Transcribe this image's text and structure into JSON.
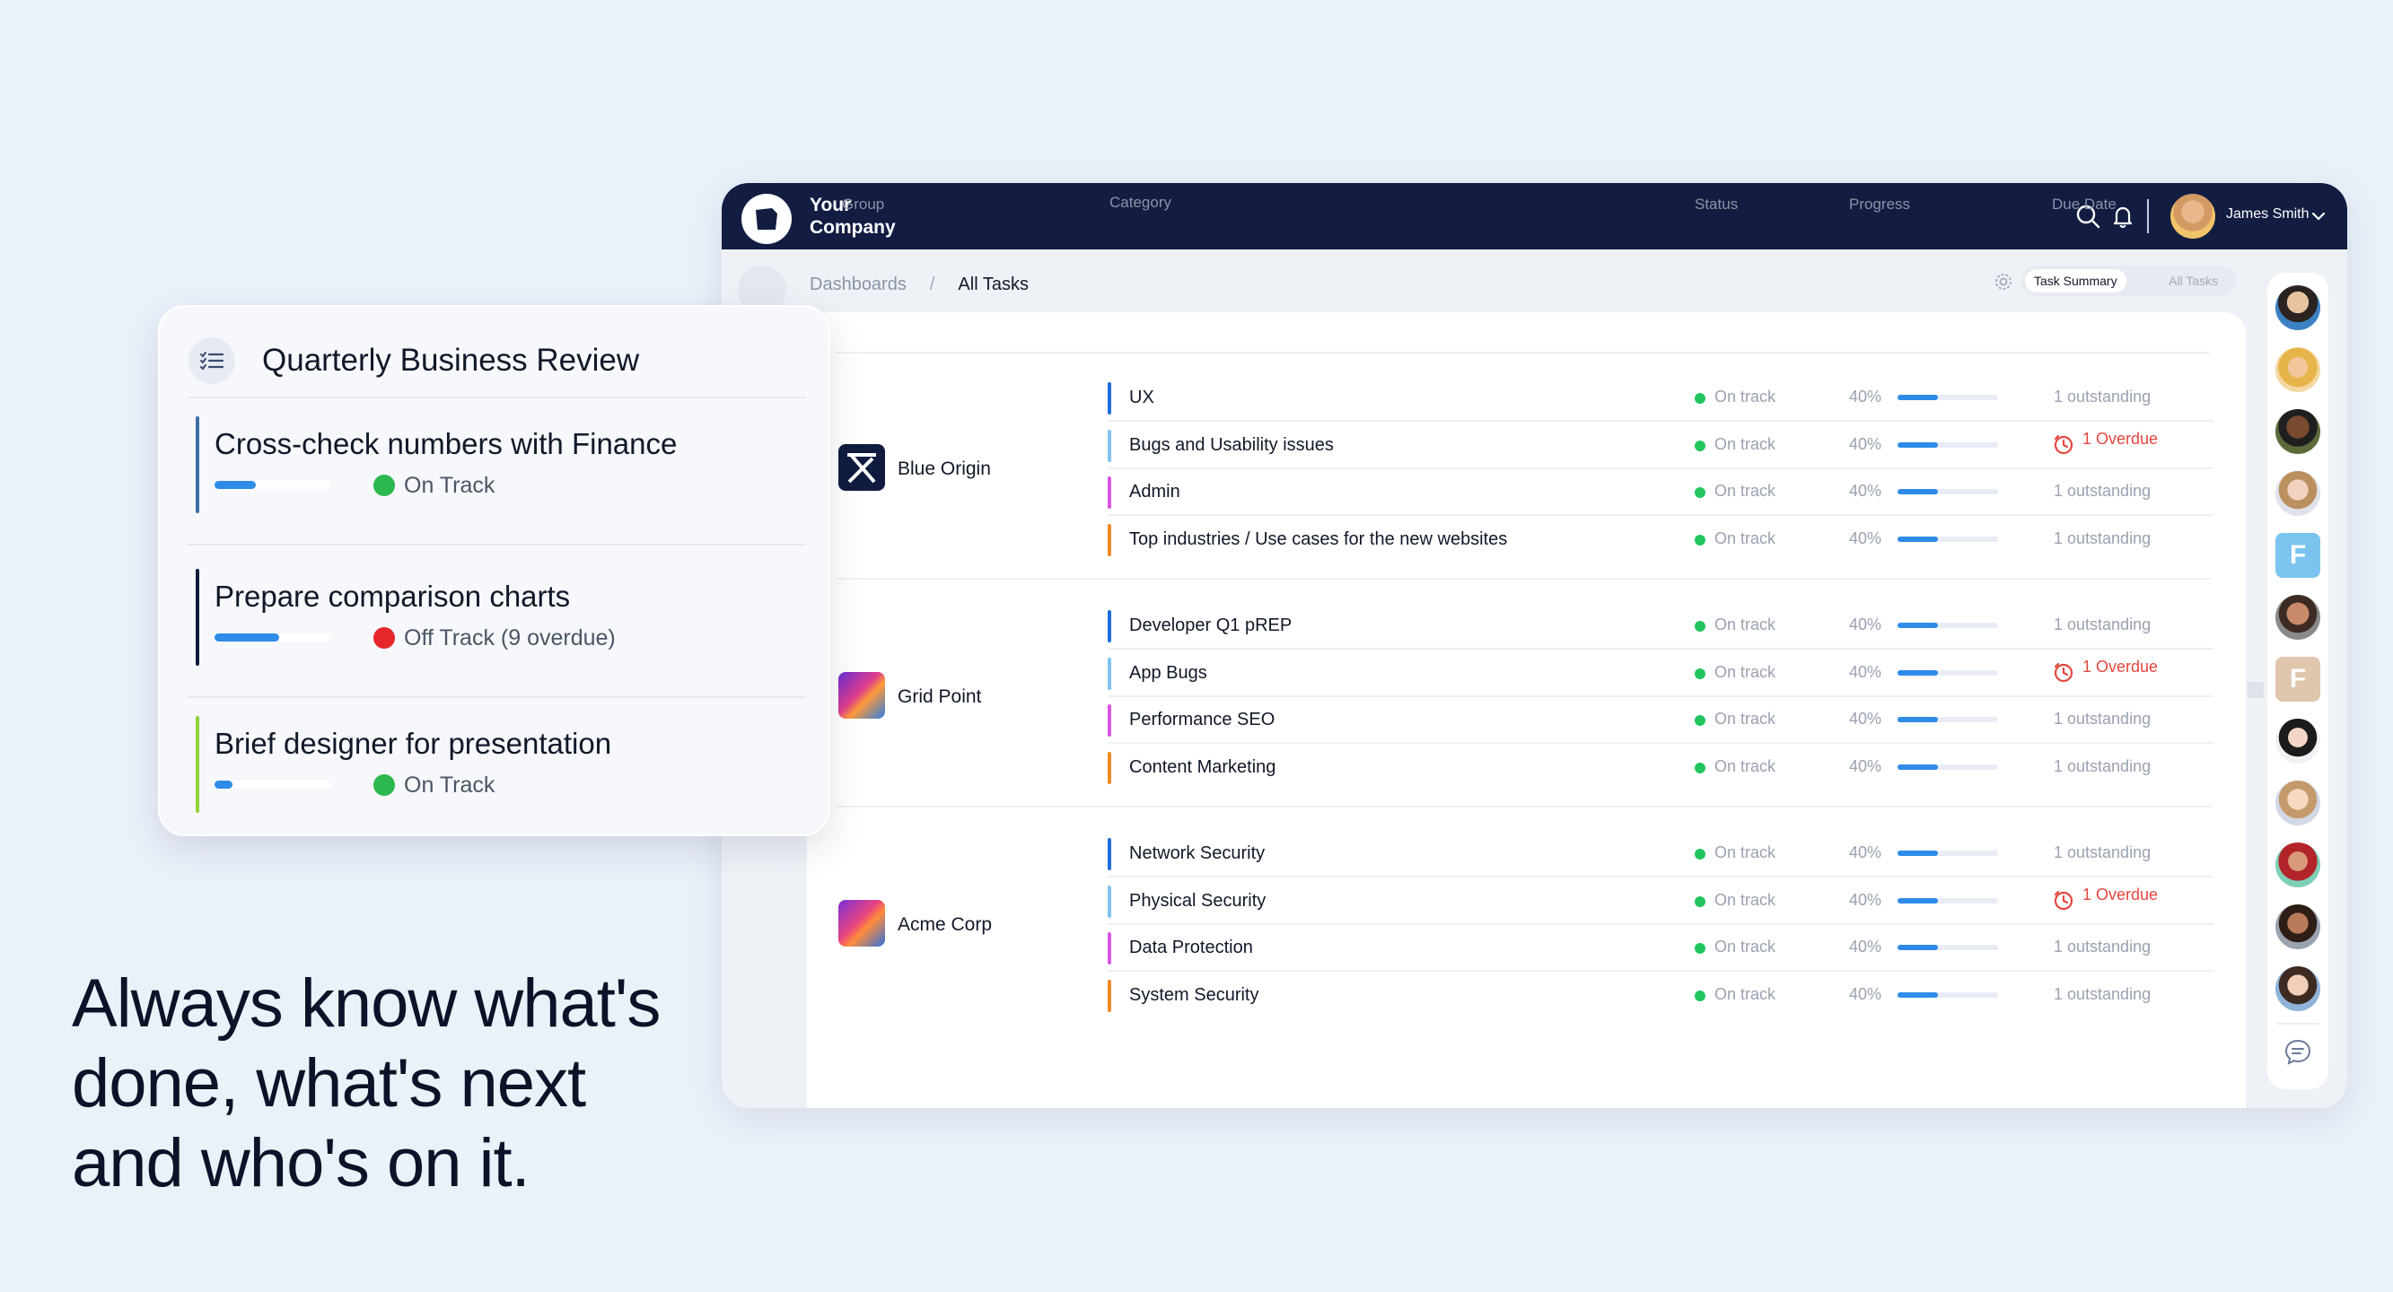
{
  "app": {
    "brand": "Your\nCompany",
    "user_name": "James Smith",
    "breadcrumbs": [
      "Dashboards",
      "/",
      "All Tasks"
    ],
    "view_toggle": {
      "active": "Task Summary",
      "other": "All Tasks"
    },
    "columns": [
      "Group",
      "Category",
      "Status",
      "Progress",
      "Due Date"
    ],
    "groups": [
      {
        "name": "Blue Origin",
        "rows": [
          {
            "category": "UX",
            "bar_color": "#1e6fd9",
            "status": "On track",
            "progress": "40%",
            "progress_value": 0.4,
            "due": "1 outstanding",
            "overdue": false
          },
          {
            "category": "Bugs and Usability issues",
            "bar_color": "#7fc3f2",
            "status": "On track",
            "progress": "40%",
            "progress_value": 0.4,
            "due": "1 Overdue",
            "overdue": true
          },
          {
            "category": "Admin",
            "bar_color": "#d957e0",
            "status": "On track",
            "progress": "40%",
            "progress_value": 0.4,
            "due": "1 outstanding",
            "overdue": false
          },
          {
            "category": "Top industries / Use cases for the new websites",
            "bar_color": "#f08a24",
            "status": "On track",
            "progress": "40%",
            "progress_value": 0.4,
            "due": "1 outstanding",
            "overdue": false
          }
        ]
      },
      {
        "name": "Grid Point",
        "rows": [
          {
            "category": "Developer Q1 pREP",
            "bar_color": "#1e6fd9",
            "status": "On track",
            "progress": "40%",
            "progress_value": 0.4,
            "due": "1 outstanding",
            "overdue": false
          },
          {
            "category": "App Bugs",
            "bar_color": "#7fc3f2",
            "status": "On track",
            "progress": "40%",
            "progress_value": 0.4,
            "due": "1 Overdue",
            "overdue": true
          },
          {
            "category": "Performance SEO",
            "bar_color": "#d957e0",
            "status": "On track",
            "progress": "40%",
            "progress_value": 0.4,
            "due": "1 outstanding",
            "overdue": false
          },
          {
            "category": "Content Marketing",
            "bar_color": "#f08a24",
            "status": "On track",
            "progress": "40%",
            "progress_value": 0.4,
            "due": "1 outstanding",
            "overdue": false
          }
        ]
      },
      {
        "name": "Acme Corp",
        "rows": [
          {
            "category": "Network Security",
            "bar_color": "#1e6fd9",
            "status": "On track",
            "progress": "40%",
            "progress_value": 0.4,
            "due": "1 outstanding",
            "overdue": false
          },
          {
            "category": "Physical Security",
            "bar_color": "#7fc3f2",
            "status": "On track",
            "progress": "40%",
            "progress_value": 0.4,
            "due": "1 Overdue",
            "overdue": true
          },
          {
            "category": "Data Protection",
            "bar_color": "#d957e0",
            "status": "On track",
            "progress": "40%",
            "progress_value": 0.4,
            "due": "1 outstanding",
            "overdue": false
          },
          {
            "category": "System Security",
            "bar_color": "#f08a24",
            "status": "On track",
            "progress": "40%",
            "progress_value": 0.4,
            "due": "1 outstanding",
            "overdue": false
          }
        ]
      }
    ],
    "rail_letters": [
      "F",
      "F"
    ]
  },
  "card": {
    "title": "Quarterly Business Review",
    "tasks": [
      {
        "title": "Cross-check numbers with Finance",
        "status": "On Track",
        "status_color": "#2cb84e",
        "bar_color": "#3b6fa3",
        "progress_value": 0.35
      },
      {
        "title": "Prepare comparison charts",
        "status": "Off Track (9 overdue)",
        "status_color": "#e5262b",
        "bar_color": "#101a3a",
        "progress_value": 0.55
      },
      {
        "title": "Brief designer for presentation",
        "status": "On Track",
        "status_color": "#2cb84e",
        "bar_color": "#8fd33a",
        "progress_value": 0.15
      }
    ]
  },
  "headline": "Always know what's\ndone, what's next\nand who's on it."
}
